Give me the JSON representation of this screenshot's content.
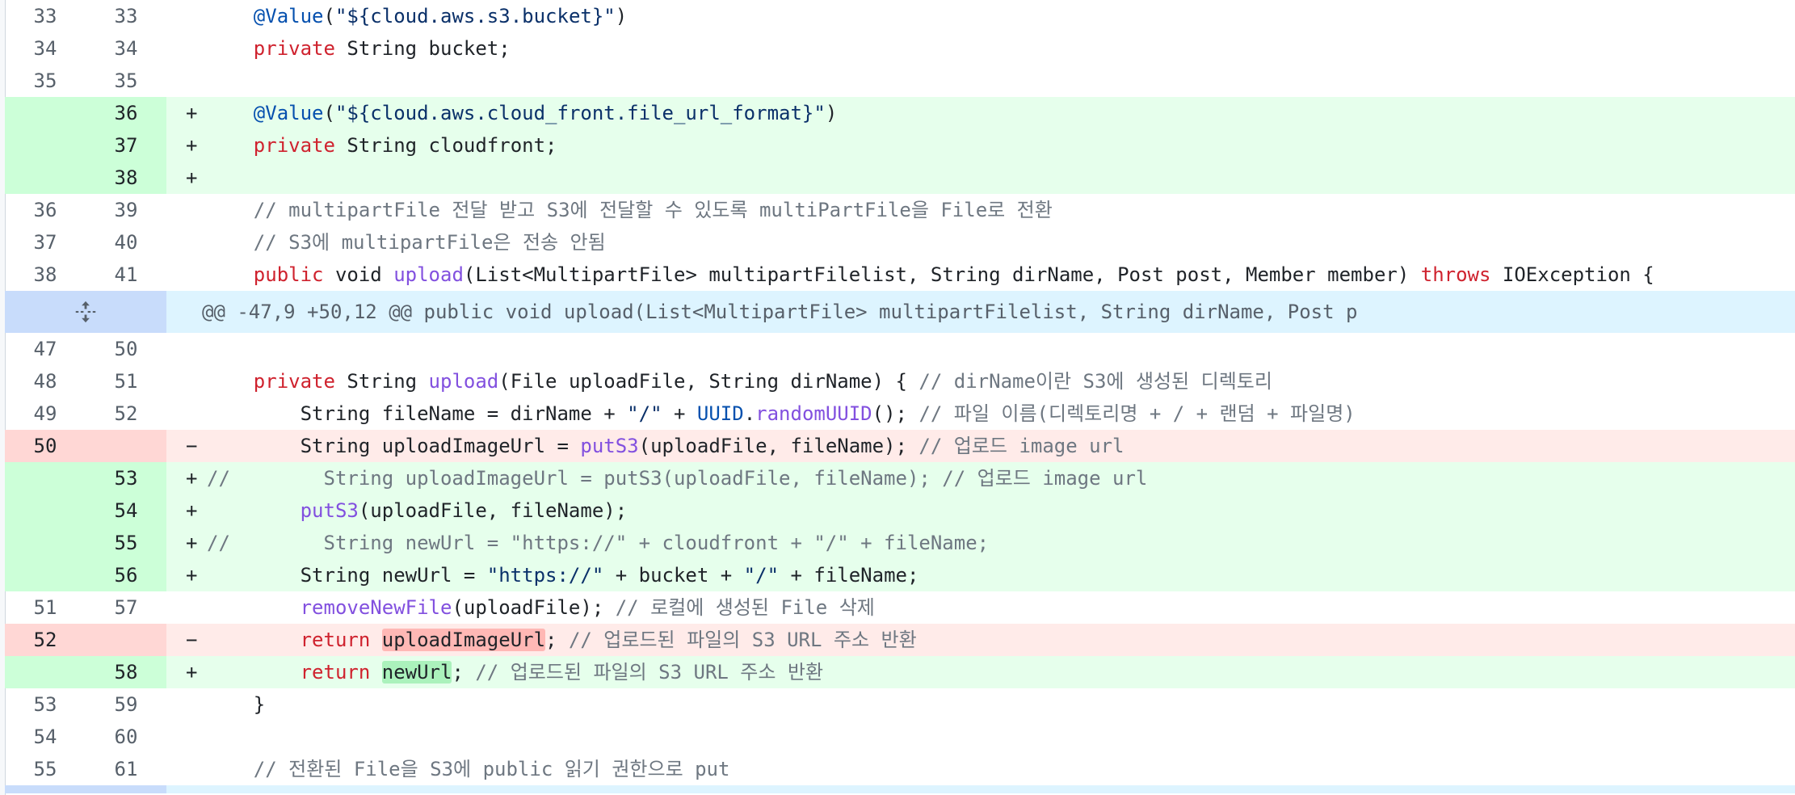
{
  "hunk_header": "@@ -47,9 +50,12 @@ public void upload(List<MultipartFile> multipartFilelist, String dirName, Post p",
  "lines": [
    {
      "old": "33",
      "new": "33",
      "sign": "",
      "type": "ctx",
      "parts": [
        [
          "    ",
          ""
        ],
        [
          "@Value",
          "ann"
        ],
        [
          "(",
          ""
        ],
        [
          "\"${cloud.aws.s3.bucket}\"",
          "str"
        ],
        [
          ")",
          ""
        ]
      ]
    },
    {
      "old": "34",
      "new": "34",
      "sign": "",
      "type": "ctx",
      "parts": [
        [
          "    ",
          ""
        ],
        [
          "private",
          "kw"
        ],
        [
          " String bucket;",
          ""
        ]
      ]
    },
    {
      "old": "35",
      "new": "35",
      "sign": "",
      "type": "ctx",
      "parts": []
    },
    {
      "old": "",
      "new": "36",
      "sign": "+",
      "type": "add",
      "parts": [
        [
          "    ",
          ""
        ],
        [
          "@Value",
          "ann"
        ],
        [
          "(",
          ""
        ],
        [
          "\"${cloud.aws.cloud_front.file_url_format}\"",
          "str"
        ],
        [
          ")",
          ""
        ]
      ]
    },
    {
      "old": "",
      "new": "37",
      "sign": "+",
      "type": "add",
      "parts": [
        [
          "    ",
          ""
        ],
        [
          "private",
          "kw"
        ],
        [
          " String cloudfront;",
          ""
        ]
      ]
    },
    {
      "old": "",
      "new": "38",
      "sign": "+",
      "type": "add",
      "parts": []
    },
    {
      "old": "36",
      "new": "39",
      "sign": "",
      "type": "ctx",
      "parts": [
        [
          "    ",
          ""
        ],
        [
          "// multipartFile 전달 받고 S3에 전달할 수 있도록 multiPartFile을 File로 전환",
          "cm"
        ]
      ]
    },
    {
      "old": "37",
      "new": "40",
      "sign": "",
      "type": "ctx",
      "parts": [
        [
          "    ",
          ""
        ],
        [
          "// S3에 multipartFile은 전송 안됨",
          "cm"
        ]
      ]
    },
    {
      "old": "38",
      "new": "41",
      "sign": "",
      "type": "ctx",
      "parts": [
        [
          "    ",
          ""
        ],
        [
          "public",
          "kw"
        ],
        [
          " void ",
          ""
        ],
        [
          "upload",
          "fn"
        ],
        [
          "(List<MultipartFile> multipartFilelist, String dirName, Post post, Member member) ",
          ""
        ],
        [
          "throws",
          "kw"
        ],
        [
          " IOException {",
          ""
        ]
      ]
    },
    {
      "type": "hunk"
    },
    {
      "old": "47",
      "new": "50",
      "sign": "",
      "type": "ctx",
      "parts": []
    },
    {
      "old": "48",
      "new": "51",
      "sign": "",
      "type": "ctx",
      "parts": [
        [
          "    ",
          ""
        ],
        [
          "private",
          "kw"
        ],
        [
          " String ",
          ""
        ],
        [
          "upload",
          "fn"
        ],
        [
          "(File uploadFile, String dirName) { ",
          ""
        ],
        [
          "// dirName이란 S3에 생성된 디렉토리",
          "cm"
        ]
      ]
    },
    {
      "old": "49",
      "new": "52",
      "sign": "",
      "type": "ctx",
      "parts": [
        [
          "        String fileName = dirName + ",
          ""
        ],
        [
          "\"/\"",
          "str"
        ],
        [
          " + ",
          ""
        ],
        [
          "UUID",
          "cls"
        ],
        [
          ".",
          ""
        ],
        [
          "randomUUID",
          "fn"
        ],
        [
          "(); ",
          ""
        ],
        [
          "// 파일 이름(디렉토리명 + / + 랜덤 + 파일명)",
          "cm"
        ]
      ]
    },
    {
      "old": "50",
      "new": "",
      "sign": "−",
      "type": "del",
      "parts": [
        [
          "        String uploadImageUrl = ",
          ""
        ],
        [
          "putS3",
          "fn"
        ],
        [
          "(uploadFile, fileName); ",
          ""
        ],
        [
          "// 업로드 image url",
          "cm"
        ]
      ]
    },
    {
      "old": "",
      "new": "53",
      "sign": "+",
      "type": "add",
      "parts": [
        [
          "//        String uploadImageUrl = putS3(uploadFile, fileName); // 업로드 image url",
          "cm"
        ]
      ]
    },
    {
      "old": "",
      "new": "54",
      "sign": "+",
      "type": "add",
      "parts": [
        [
          "        ",
          ""
        ],
        [
          "putS3",
          "fn"
        ],
        [
          "(uploadFile, fileName);",
          ""
        ]
      ]
    },
    {
      "old": "",
      "new": "55",
      "sign": "+",
      "type": "add",
      "parts": [
        [
          "//        String newUrl = \"https://\" + cloudfront + \"/\" + fileName;",
          "cm"
        ]
      ]
    },
    {
      "old": "",
      "new": "56",
      "sign": "+",
      "type": "add",
      "parts": [
        [
          "        String newUrl = ",
          ""
        ],
        [
          "\"https://\"",
          "str"
        ],
        [
          " + bucket + ",
          ""
        ],
        [
          "\"/\"",
          "str"
        ],
        [
          " + fileName;",
          ""
        ]
      ]
    },
    {
      "old": "51",
      "new": "57",
      "sign": "",
      "type": "ctx",
      "parts": [
        [
          "        ",
          ""
        ],
        [
          "removeNewFile",
          "fn"
        ],
        [
          "(uploadFile); ",
          ""
        ],
        [
          "// 로컬에 생성된 File 삭제",
          "cm"
        ]
      ]
    },
    {
      "old": "52",
      "new": "",
      "sign": "−",
      "type": "del",
      "parts": [
        [
          "        ",
          ""
        ],
        [
          "return",
          "kw"
        ],
        [
          " ",
          ""
        ],
        [
          "uploadImageUrl",
          "hl-del"
        ],
        [
          "; ",
          ""
        ],
        [
          "// 업로드된 파일의 S3 URL 주소 반환",
          "cm"
        ]
      ]
    },
    {
      "old": "",
      "new": "58",
      "sign": "+",
      "type": "add",
      "parts": [
        [
          "        ",
          ""
        ],
        [
          "return",
          "kw"
        ],
        [
          " ",
          ""
        ],
        [
          "newUrl",
          "hl-add"
        ],
        [
          "; ",
          ""
        ],
        [
          "// 업로드된 파일의 S3 URL 주소 반환",
          "cm"
        ]
      ]
    },
    {
      "old": "53",
      "new": "59",
      "sign": "",
      "type": "ctx",
      "parts": [
        [
          "    }",
          ""
        ]
      ]
    },
    {
      "old": "54",
      "new": "60",
      "sign": "",
      "type": "ctx",
      "parts": []
    },
    {
      "old": "55",
      "new": "61",
      "sign": "",
      "type": "ctx",
      "parts": [
        [
          "    ",
          ""
        ],
        [
          "// 전환된 File을 S3에 public 읽기 권한으로 put",
          "cm"
        ]
      ]
    }
  ]
}
